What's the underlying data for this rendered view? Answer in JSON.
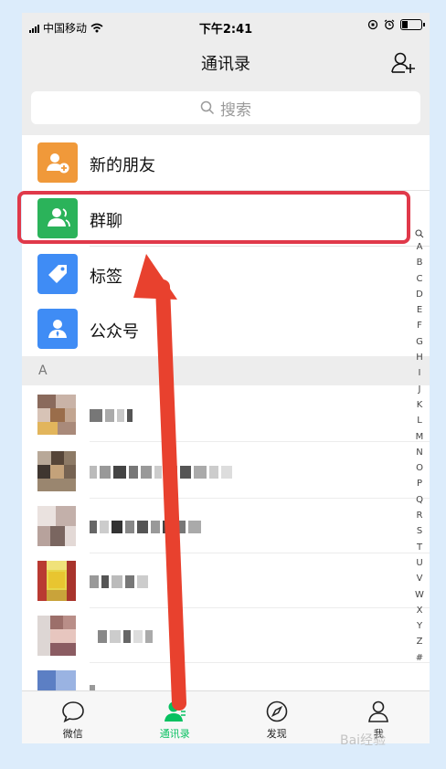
{
  "status_bar": {
    "carrier": "中国移动",
    "time": "下午2:41"
  },
  "nav": {
    "title": "通讯录"
  },
  "search": {
    "placeholder": "搜索"
  },
  "menu_items": [
    {
      "label": "新的朋友",
      "icon": "add-friend-icon",
      "color": "#f0993a"
    },
    {
      "label": "群聊",
      "icon": "group-icon",
      "color": "#2bb35a"
    },
    {
      "label": "标签",
      "icon": "tag-icon",
      "color": "#3f8cf5"
    },
    {
      "label": "公众号",
      "icon": "official-account-icon",
      "color": "#3f8cf5"
    }
  ],
  "section": {
    "letter": "A"
  },
  "index_letters": [
    "A",
    "B",
    "C",
    "D",
    "E",
    "F",
    "G",
    "H",
    "I",
    "J",
    "K",
    "L",
    "M",
    "N",
    "O",
    "P",
    "Q",
    "R",
    "S",
    "T",
    "U",
    "V",
    "W",
    "X",
    "Y",
    "Z",
    "#"
  ],
  "tabs": [
    {
      "label": "微信",
      "icon": "chat-bubble-icon"
    },
    {
      "label": "通讯录",
      "icon": "contacts-icon",
      "active": true
    },
    {
      "label": "发现",
      "icon": "compass-icon"
    },
    {
      "label": "我",
      "icon": "person-icon"
    }
  ],
  "accent_color": "#07c160",
  "annotation_color": "#e0394a",
  "watermark": "Bai经验"
}
